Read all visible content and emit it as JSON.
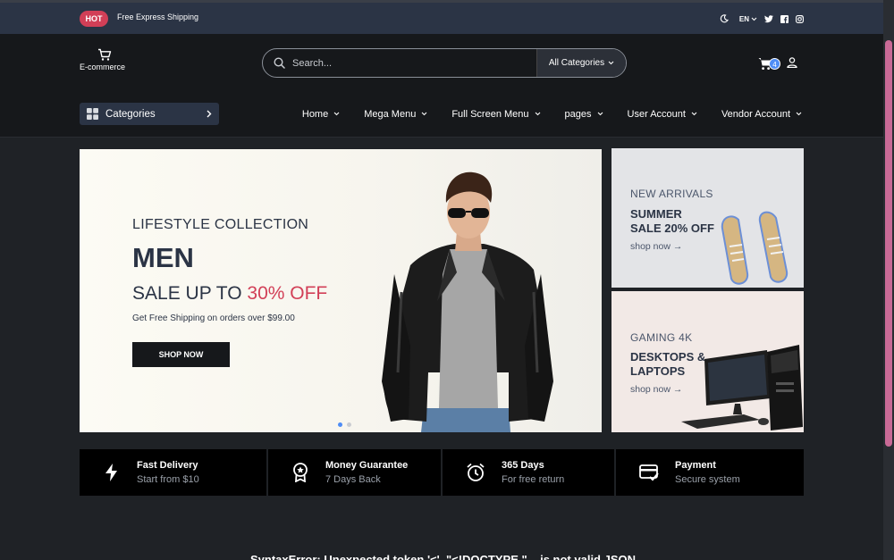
{
  "topbar": {
    "hot_badge": "HOT",
    "shipping_text": "Free Express Shipping",
    "language": "EN",
    "icons": [
      "moon-icon",
      "twitter-icon",
      "facebook-icon",
      "instagram-icon"
    ]
  },
  "header": {
    "logo_text": "E-commerce",
    "search_placeholder": "Search...",
    "category_select": "All Categories",
    "cart_count": "4"
  },
  "navbar": {
    "categories_label": "Categories",
    "items": [
      "Home",
      "Mega Menu",
      "Full Screen Menu",
      "pages",
      "User Account",
      "Vendor Account"
    ]
  },
  "hero": {
    "subtitle": "LIFESTYLE COLLECTION",
    "title": "MEN",
    "sale_prefix": "SALE UP TO ",
    "sale_percent": "30% OFF",
    "info": "Get Free Shipping on orders over $99.00",
    "button": "SHOP NOW",
    "slides_total": 2,
    "active_slide": 1
  },
  "promos": [
    {
      "tag": "NEW ARRIVALS",
      "title_line1": "SUMMER",
      "title_line2": "SALE 20% OFF",
      "link": "shop now →"
    },
    {
      "tag": "GAMING 4K",
      "title_line1": "DESKTOPS &",
      "title_line2": "LAPTOPS",
      "link": "shop now →"
    }
  ],
  "services": [
    {
      "icon": "lightning-icon",
      "title": "Fast Delivery",
      "subtitle": "Start from $10"
    },
    {
      "icon": "medal-icon",
      "title": "Money Guarantee",
      "subtitle": "7 Days Back"
    },
    {
      "icon": "alarm-clock-icon",
      "title": "365 Days",
      "subtitle": "For free return"
    },
    {
      "icon": "credit-card-icon",
      "title": "Payment",
      "subtitle": "Secure system"
    }
  ],
  "error_message": "SyntaxError: Unexpected token '<', \"<!DOCTYPE \"... is not valid JSON",
  "colors": {
    "accent": "#d23f57",
    "topbar": "#2b3445",
    "header": "#16181b",
    "page_bg": "#1f2226",
    "slider_dot": "#4f8df5"
  }
}
